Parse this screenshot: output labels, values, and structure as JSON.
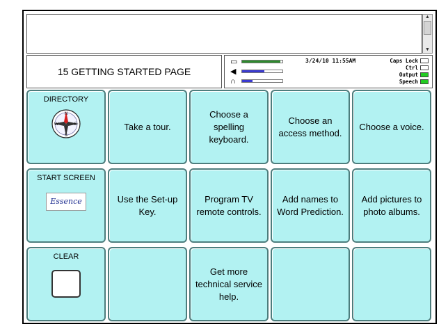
{
  "page_title": "15 GETTING STARTED PAGE",
  "status": {
    "datetime": "3/24/10 11:55AM",
    "indicators": [
      {
        "label": "Caps Lock",
        "on": false
      },
      {
        "label": "Ctrl",
        "on": false
      },
      {
        "label": "Output",
        "on": true
      },
      {
        "label": "Speech",
        "on": true
      }
    ],
    "icons": [
      "battery-icon",
      "speaker-icon",
      "headphones-icon"
    ],
    "meters": [
      {
        "name": "battery",
        "level": 0.95,
        "color": "#2e8b2e"
      },
      {
        "name": "volume",
        "level": 0.55,
        "color": "#3a3ad0"
      },
      {
        "name": "headphone",
        "level": 0.25,
        "color": "#3a3ad0"
      }
    ]
  },
  "special_keys": {
    "directory": {
      "label": "DIRECTORY",
      "icon": "compass-icon",
      "compass_letters": [
        "N",
        "E",
        "S",
        "W"
      ]
    },
    "start_screen": {
      "label": "START SCREEN",
      "logo": "Essence"
    },
    "clear": {
      "label": "CLEAR"
    }
  },
  "buttons": {
    "take_tour": "Take a tour.",
    "spelling_keyboard": "Choose a spelling keyboard.",
    "access_method": "Choose an access method.",
    "choose_voice": "Choose a voice.",
    "setup_key": "Use the Set-up Key.",
    "tv_remote": "Program TV remote controls.",
    "word_prediction": "Add names to Word Prediction.",
    "photo_albums": "Add pictures to photo albums.",
    "tech_service": "Get more technical service help."
  },
  "colors": {
    "button_fill": "#b2f2f2",
    "button_border": "#4d7d7d",
    "indicator_on": "#22cc22"
  }
}
